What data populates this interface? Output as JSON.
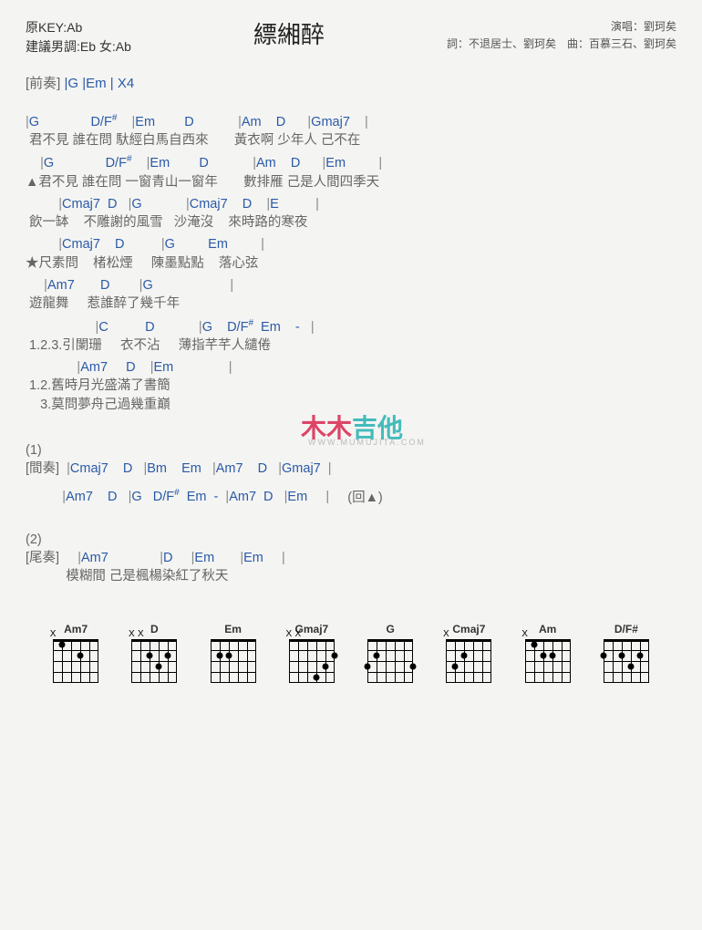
{
  "header": {
    "original_key": "原KEY:Ab",
    "suggested": "建議男調:Eb 女:Ab",
    "title": "縹緗醉",
    "singer_prefix": "演唱：",
    "singer": "劉珂矣",
    "credits2": "詞：不退居士、劉珂矣　曲：百慕三石、劉珂矣"
  },
  "intro": {
    "label": "[前奏]",
    "chords": " |G    |Em    | X4"
  },
  "lines": [
    {
      "chords": "|G              D/F#    |Em        D            |Am    D      |Gmaj7    |",
      "lyrics": " 君不見 誰在問 馱經白馬自西來       黃衣啊 少年人 己不在"
    },
    {
      "chords": "    |G              D/F#    |Em        D            |Am    D      |Em         |",
      "lyrics": "▲君不見 誰在問 一窗青山一窗年       數排雁 己是人間四季天"
    },
    {
      "chords": "         |Cmaj7  D   |G            |Cmaj7    D    |E          |",
      "lyrics": " 飲一缽    不雕謝的風雪   沙淹沒    來時路的寒夜"
    },
    {
      "chords": "         |Cmaj7    D          |G         Em         |",
      "lyrics": "★尺素問    楮松煙     陳墨點點    落心弦"
    },
    {
      "chords": "     |Am7       D        |G                     |",
      "lyrics": " 遊龍舞     惹誰醉了幾千年"
    },
    {
      "chords": "                   |C          D            |G    D/F#  Em    -   |",
      "lyrics": " 1.2.3.引闌珊     衣不沾     薄指芊芊人繾倦"
    },
    {
      "chords": "              |Am7     D    |Em               |",
      "lyrics": " 1.2.舊時月光盛滿了書簡",
      "lyrics2": "    3.莫問夢舟己過幾重巔"
    }
  ],
  "section1": {
    "num": "(1)",
    "l1_label": "[間奏]",
    "l1_chords": "  |Cmaj7    D   |Bm    Em   |Am7    D   |Gmaj7  |",
    "l2_chords": "          |Am7    D   |G   D/F#  Em  -  |Am7  D   |Em     |     ",
    "l2_tail": "(回▲)"
  },
  "section2": {
    "num": "(2)",
    "label": "[尾奏]",
    "chords": "     |Am7              |D     |Em       |Em     |",
    "lyrics": "           模糊間 己是楓楊染紅了秋天"
  },
  "watermark": {
    "a": "木木",
    "b": "吉他",
    "sub": "WWW.MUMUJITA.COM"
  },
  "diagrams": [
    {
      "name": "Am7",
      "mutes": [
        0
      ],
      "dots": [
        [
          1,
          1
        ],
        [
          3,
          2
        ]
      ]
    },
    {
      "name": "D",
      "mutes": [
        0,
        1
      ],
      "dots": [
        [
          2,
          2
        ],
        [
          4,
          2
        ],
        [
          3,
          3
        ]
      ]
    },
    {
      "name": "Em",
      "mutes": [],
      "dots": [
        [
          1,
          2
        ],
        [
          2,
          2
        ]
      ]
    },
    {
      "name": "Gmaj7",
      "mutes": [
        0,
        1
      ],
      "dots": [
        [
          5,
          2
        ],
        [
          4,
          3
        ],
        [
          3,
          4
        ]
      ]
    },
    {
      "name": "G",
      "mutes": [],
      "dots": [
        [
          1,
          2
        ],
        [
          0,
          3
        ],
        [
          5,
          3
        ]
      ]
    },
    {
      "name": "Cmaj7",
      "mutes": [
        0
      ],
      "dots": [
        [
          2,
          2
        ],
        [
          1,
          3
        ]
      ]
    },
    {
      "name": "Am",
      "mutes": [
        0
      ],
      "dots": [
        [
          1,
          1
        ],
        [
          2,
          2
        ],
        [
          3,
          2
        ]
      ]
    },
    {
      "name": "D/F#",
      "mutes": [],
      "dots": [
        [
          0,
          2
        ],
        [
          2,
          2
        ],
        [
          4,
          2
        ],
        [
          3,
          3
        ]
      ]
    }
  ]
}
